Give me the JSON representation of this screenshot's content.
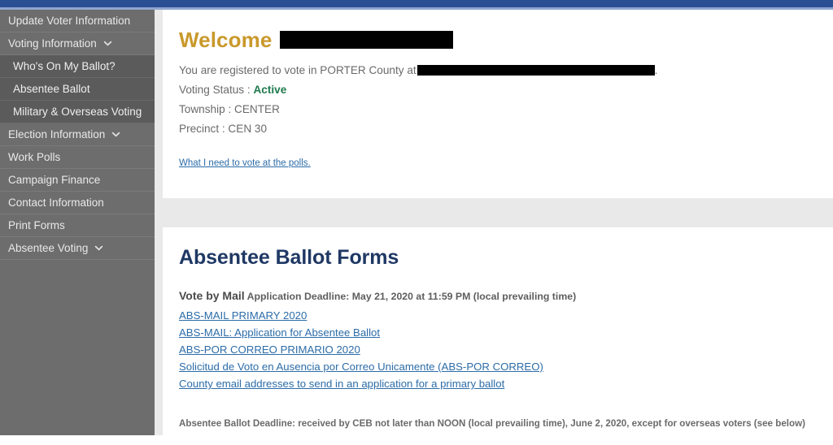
{
  "theme": {
    "topbar_blue": "#2b4f93",
    "sidebar_gray": "#6d6d6d",
    "submenu_gray": "#5b5b5b",
    "welcome_gold": "#c9992c",
    "link_blue": "#2c6ca8",
    "heading_navy": "#1f3864",
    "status_green": "#1f7a4d"
  },
  "sidebar": {
    "items": [
      {
        "label": "Update Voter Information",
        "sub": false,
        "chevron": false
      },
      {
        "label": "Voting Information",
        "sub": false,
        "chevron": true
      },
      {
        "label": "Who's On My Ballot?",
        "sub": true,
        "chevron": false
      },
      {
        "label": "Absentee Ballot",
        "sub": true,
        "chevron": false
      },
      {
        "label": "Military & Overseas Voting",
        "sub": true,
        "chevron": false
      },
      {
        "label": "Election Information",
        "sub": false,
        "chevron": true
      },
      {
        "label": "Work Polls",
        "sub": false,
        "chevron": false
      },
      {
        "label": "Campaign Finance",
        "sub": false,
        "chevron": false
      },
      {
        "label": "Contact Information",
        "sub": false,
        "chevron": false
      },
      {
        "label": "Print Forms",
        "sub": false,
        "chevron": false
      },
      {
        "label": "Absentee Voting",
        "sub": false,
        "chevron": true
      }
    ]
  },
  "welcome_card": {
    "heading": "Welcome",
    "name_redacted": true,
    "registration_prefix": "You are registered to vote in PORTER County at",
    "registration_suffix": ".",
    "address_redacted": true,
    "voting_status_label": "Voting Status :",
    "voting_status_value": "Active",
    "township_line": "Township : CENTER",
    "precinct_line": "Precinct : CEN 30",
    "polls_link": "What I need to vote at the polls."
  },
  "forms_card": {
    "title": "Absentee Ballot Forms",
    "vote_by_mail_label": "Vote by Mail",
    "vote_by_mail_deadline": "Application Deadline: May 21, 2020 at 11:59 PM (local prevailing time)",
    "links": [
      "ABS-MAIL PRIMARY 2020",
      "ABS-MAIL: Application for Absentee Ballot",
      "ABS-POR CORREO PRIMARIO 2020",
      "Solicitud de Voto en Ausencia por Correo Unicamente (ABS-POR CORREO)",
      "County email addresses to send in an application for a primary ballot"
    ],
    "deadline_note": "Absentee Ballot Deadline: received by CEB not later than NOON (local prevailing time), June 2, 2020, except for overseas voters (see below)"
  }
}
